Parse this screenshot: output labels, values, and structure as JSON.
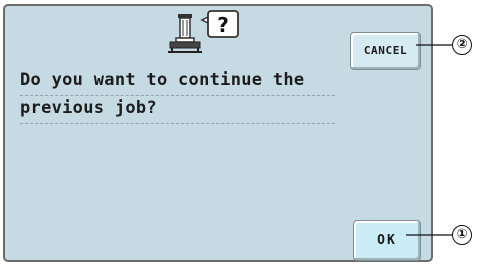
{
  "dialog": {
    "icon": "embroidery-machine-question-icon",
    "question_glyph": "?",
    "message_lines": [
      "Do you want to continue the",
      "previous job?"
    ],
    "cancel_label": "CANCEL",
    "ok_label": "OK"
  },
  "callouts": {
    "cancel_number": "②",
    "ok_number": "①"
  },
  "colors": {
    "screen_background": "#c5dae2",
    "button_face": "#d6eaf2",
    "ok_button_face": "#c9ecf7",
    "text": "#1c1c1c"
  }
}
